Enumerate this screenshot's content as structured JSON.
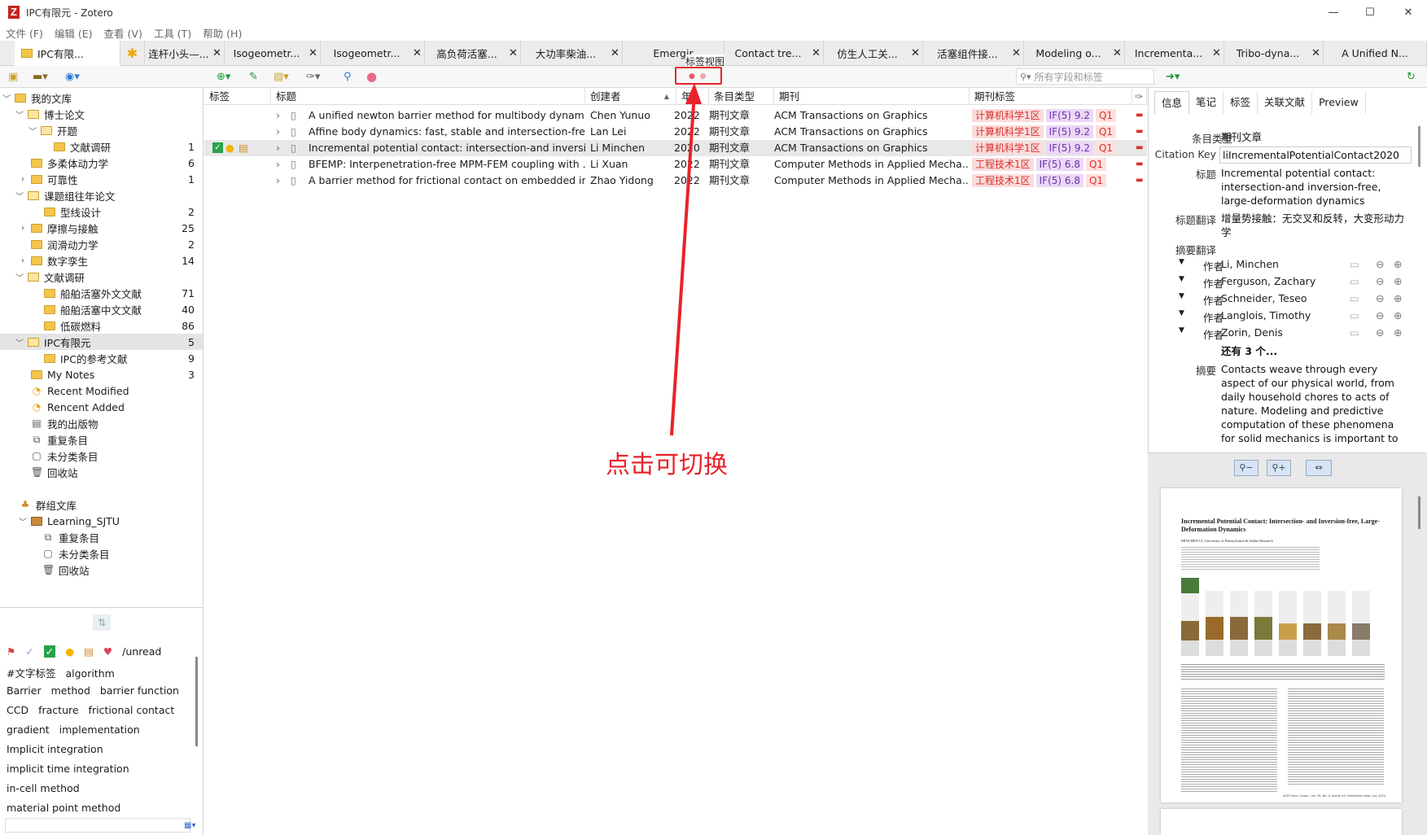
{
  "window": {
    "title": "IPC有限元 - Zotero",
    "logo_letter": "Z",
    "controls": [
      "—",
      "☐",
      "✕"
    ]
  },
  "menu": [
    "文件 (F)",
    "编辑 (E)",
    "查看 (V)",
    "工具 (T)",
    "帮助 (H)"
  ],
  "tabs": [
    {
      "label": "IPC有限..."
    },
    {
      "label": "连杆小头—..."
    },
    {
      "label": "Isogeometr..."
    },
    {
      "label": "Isogeometr..."
    },
    {
      "label": "高负荷活塞..."
    },
    {
      "label": "大功率柴油..."
    },
    {
      "label": "Emergir"
    },
    {
      "label": "Contact tre..."
    },
    {
      "label": "仿生人工关..."
    },
    {
      "label": "活塞组件接..."
    },
    {
      "label": "Modeling o..."
    },
    {
      "label": "Incrementa..."
    },
    {
      "label": "Tribo-dyna..."
    },
    {
      "label": "A Unified N..."
    }
  ],
  "tab_close": "✕",
  "toolbar": {
    "search_placeholder": "所有字段和标签",
    "view_tooltip": "标签视图"
  },
  "library": {
    "rows": [
      {
        "label": "我的文库",
        "count": ""
      },
      {
        "label": "博士论文",
        "count": ""
      },
      {
        "label": "开题",
        "count": ""
      },
      {
        "label": "文献调研",
        "count": "1"
      },
      {
        "label": "多柔体动力学",
        "count": "6"
      },
      {
        "label": "可靠性",
        "count": "1"
      },
      {
        "label": "课题组往年论文",
        "count": ""
      },
      {
        "label": "型线设计",
        "count": "2"
      },
      {
        "label": "摩擦与接触",
        "count": "25"
      },
      {
        "label": "润滑动力学",
        "count": "2"
      },
      {
        "label": "数字孪生",
        "count": "14"
      },
      {
        "label": "文献调研",
        "count": ""
      },
      {
        "label": "船舶活塞外文文献",
        "count": "71"
      },
      {
        "label": "船舶活塞中文文献",
        "count": "40"
      },
      {
        "label": "低碳燃料",
        "count": "86"
      },
      {
        "label": "IPC有限元",
        "count": "5"
      },
      {
        "label": "IPC的参考文献",
        "count": "9"
      },
      {
        "label": "My Notes",
        "count": "3"
      },
      {
        "label": "Recent Modified",
        "count": ""
      },
      {
        "label": "Rencent Added",
        "count": ""
      },
      {
        "label": "我的出版物",
        "count": ""
      },
      {
        "label": "重复条目",
        "count": ""
      },
      {
        "label": "未分类条目",
        "count": ""
      },
      {
        "label": "回收站",
        "count": ""
      },
      {
        "label": "群组文库",
        "count": ""
      },
      {
        "label": "Learning_SJTU",
        "count": ""
      },
      {
        "label": "重复条目",
        "count": ""
      },
      {
        "label": "未分类条目",
        "count": ""
      },
      {
        "label": "回收站",
        "count": ""
      }
    ]
  },
  "tag_selector": {
    "emoji_row_label": "/unread",
    "tags": [
      "#文字标签",
      "algorithm",
      "Barrier",
      "method",
      "barrier function",
      "CCD",
      "fracture",
      "frictional contact",
      "gradient",
      "implementation",
      "Implicit integration",
      "implicit time integration",
      "in-cell method",
      "material point method"
    ]
  },
  "columns": {
    "tags": "标签",
    "title": "标题",
    "creator": "创建者",
    "year": "年",
    "type": "条目类型",
    "journal": "期刊",
    "jtags": "期刊标签"
  },
  "items": [
    {
      "title": "A unified newton barrier method for multibody dynamics",
      "creator": "Chen Yunuo",
      "year": "2022",
      "type": "期刊文章",
      "journal": "ACM Transactions on Graphics",
      "zone": "计算机科学1区",
      "if": "IF(5) 9.2",
      "q": "Q1"
    },
    {
      "title": "Affine body dynamics: fast, stable and intersection-free ...",
      "creator": "Lan Lei",
      "year": "2022",
      "type": "期刊文章",
      "journal": "ACM Transactions on Graphics",
      "zone": "计算机科学1区",
      "if": "IF(5) 9.2",
      "q": "Q1"
    },
    {
      "title": "Incremental potential contact: intersection-and inversio...",
      "creator": "Li Minchen",
      "year": "2020",
      "type": "期刊文章",
      "journal": "ACM Transactions on Graphics",
      "zone": "计算机科学1区",
      "if": "IF(5) 9.2",
      "q": "Q1"
    },
    {
      "title": "BFEMP: Interpenetration-free MPM-FEM coupling with ...",
      "creator": "Li Xuan",
      "year": "2022",
      "type": "期刊文章",
      "journal": "Computer Methods in Applied Mecha...",
      "zone": "工程技术1区",
      "if": "IF(5) 6.8",
      "q": "Q1"
    },
    {
      "title": "A barrier method for frictional contact on embedded int...",
      "creator": "Zhao Yidong",
      "year": "2022",
      "type": "期刊文章",
      "journal": "Computer Methods in Applied Mecha...",
      "zone": "工程技术1区",
      "if": "IF(5) 6.8",
      "q": "Q1"
    }
  ],
  "right": {
    "tabs": [
      "信息",
      "笔记",
      "标签",
      "关联文献",
      "Preview"
    ],
    "item_type_label": "条目类型",
    "item_type": "期刊文章",
    "citekey_label": "Citation Key",
    "citekey": "liIncrementalPotentialContact2020",
    "title_label": "标题",
    "title": "Incremental potential contact: intersection-and inversion-free, large-deformation dynamics",
    "trans_label": "标题翻译",
    "trans": "增量势接触：无交叉和反转，大变形动力学",
    "abs_trans_label": "摘要翻译",
    "author_label": "作者",
    "authors": [
      "Li, Minchen",
      "Ferguson, Zachary",
      "Schneider, Teseo",
      "Langlois, Timothy",
      "Zorin, Denis"
    ],
    "more": "还有 3 个...",
    "abstract_label": "摘要",
    "abstract": "Contacts weave through every aspect of our physical world, from daily household chores to acts of nature. Modeling and predictive computation of these phenomena for solid mechanics is important to every"
  },
  "preview": {
    "paper_title": "Incremental Potential Contact: Intersection- and Inversion-free, Large-Deformation Dynamics",
    "authors_line": "MINCHEN LI, University of Pennsylvania & Adobe Research",
    "footer": "ACM Trans. Graph., Vol. 39, No. 4, Article 49. Publication date: July 2020."
  },
  "annotation": {
    "text": "点击可切换",
    "color": "#e8232a"
  }
}
